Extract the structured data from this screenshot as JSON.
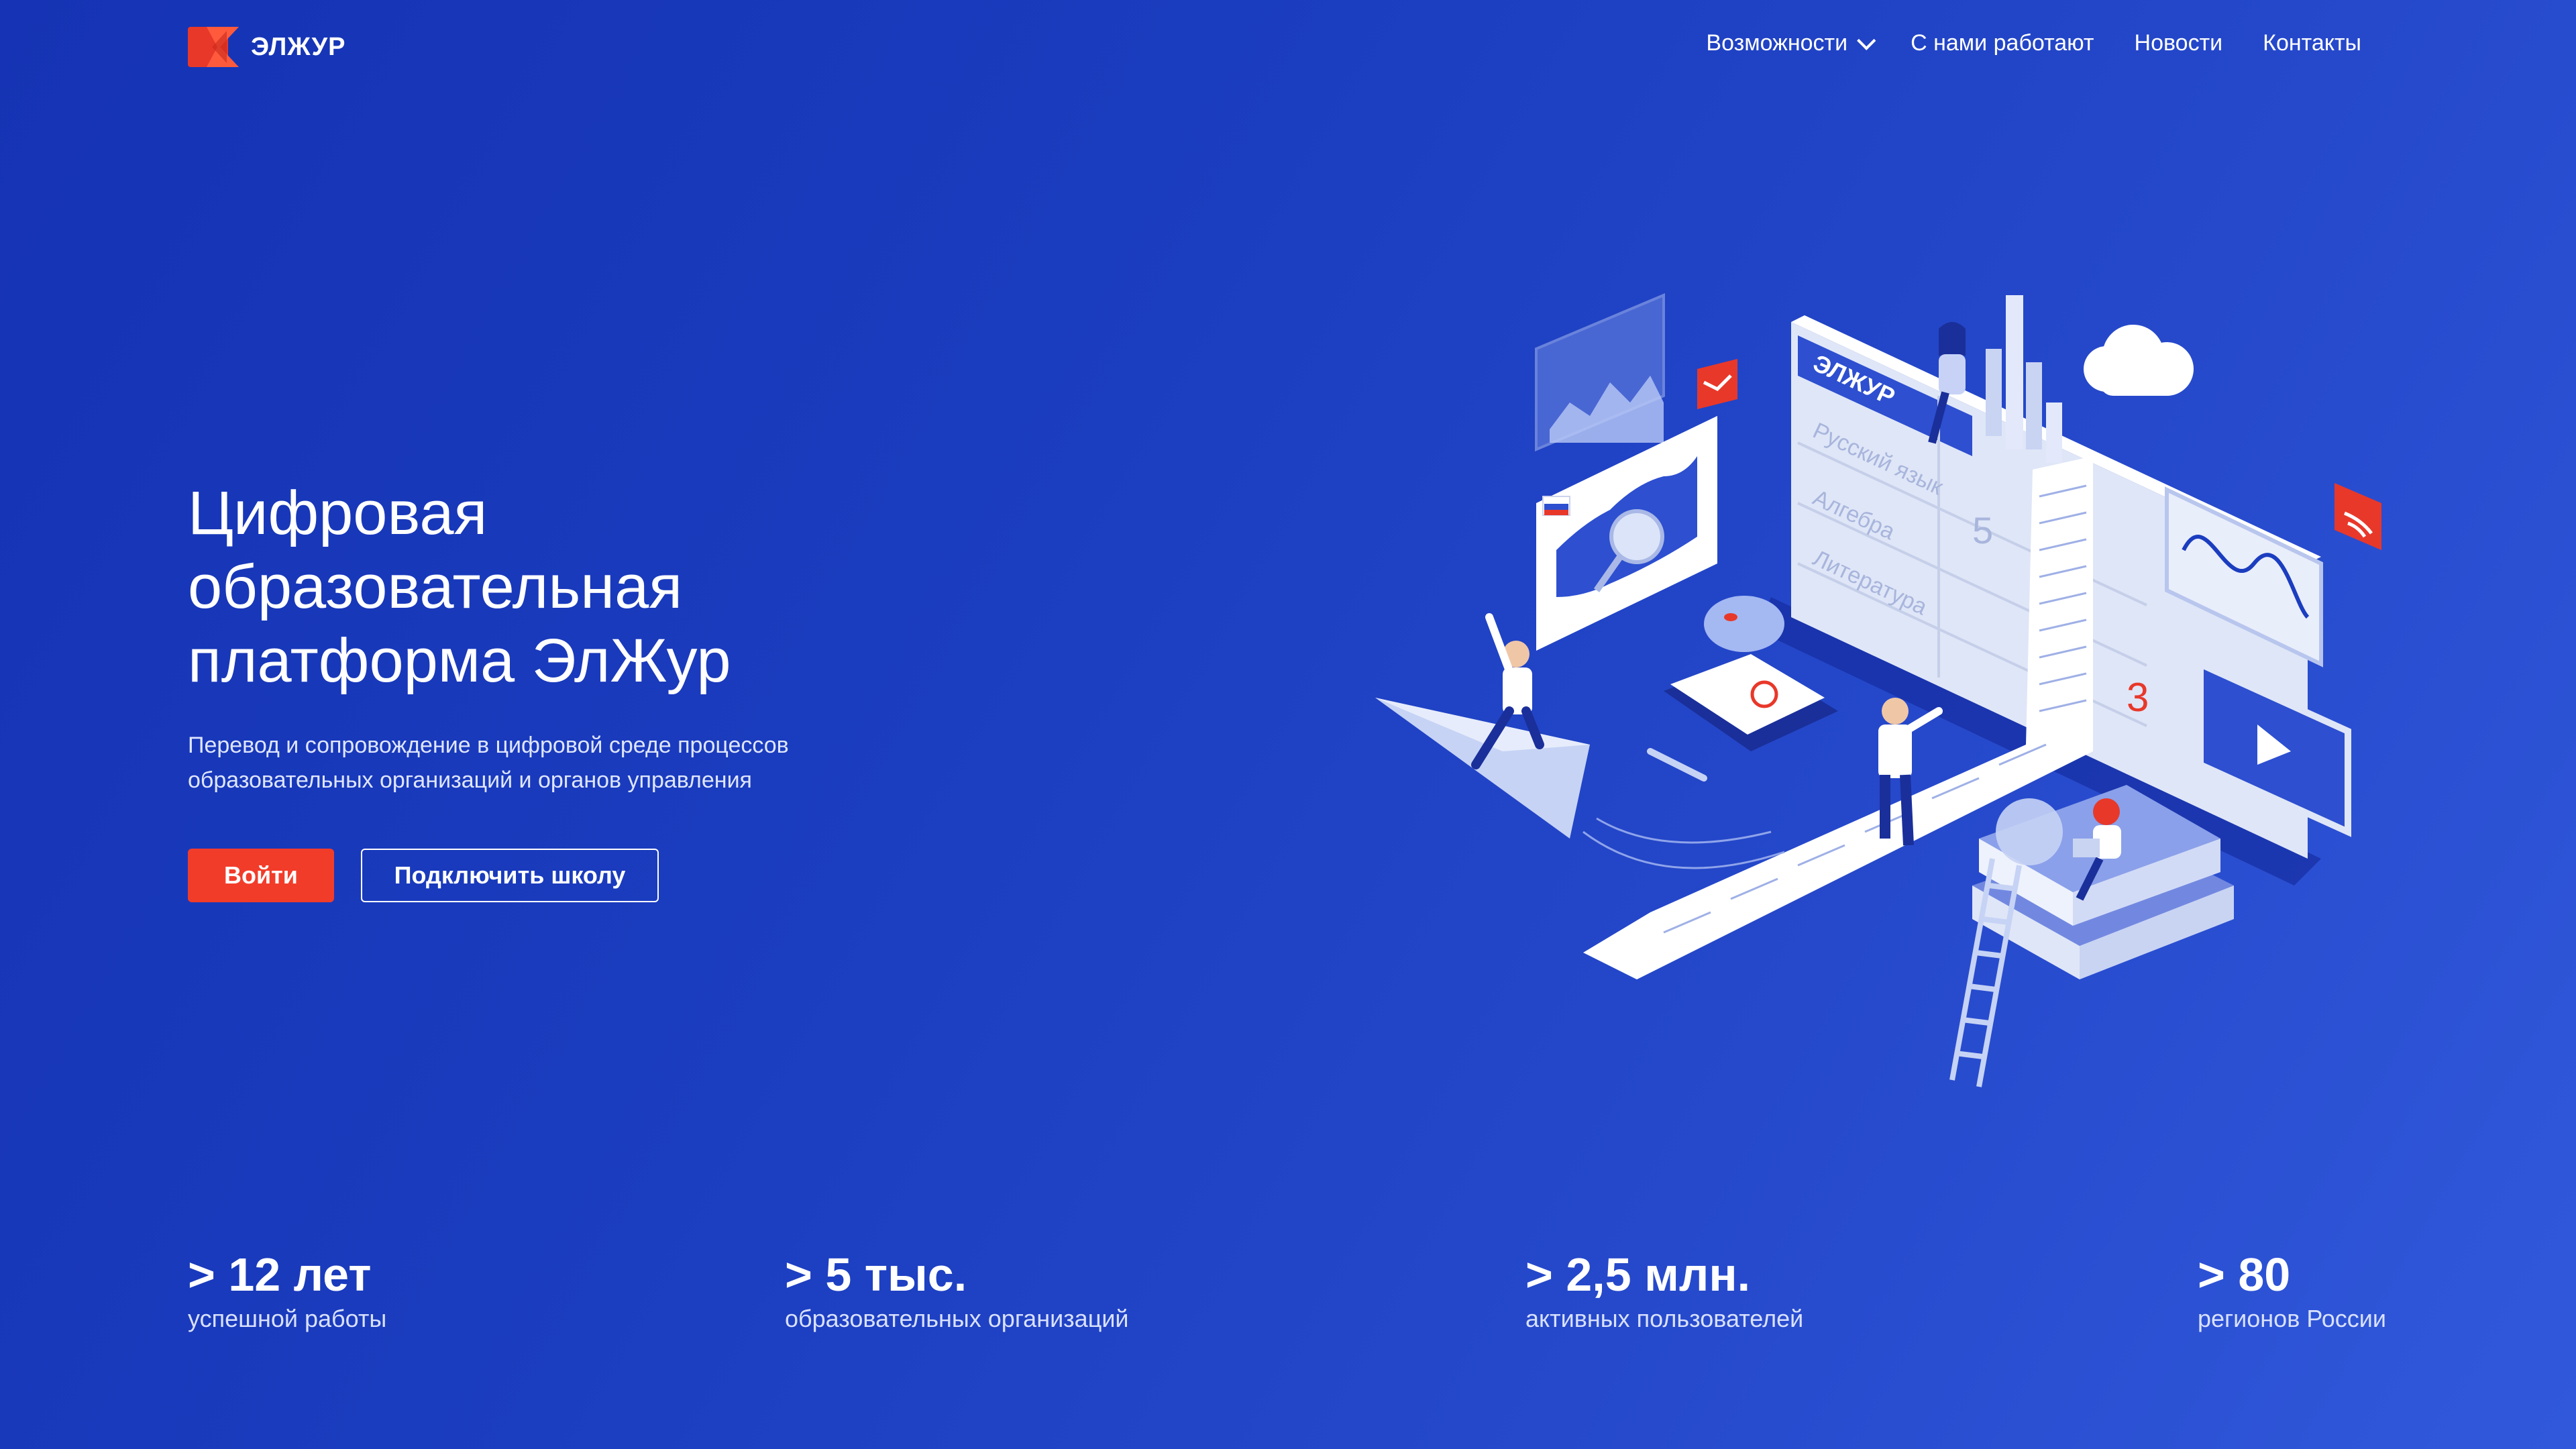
{
  "header": {
    "logo_text": "ЭЛЖУР",
    "nav": [
      {
        "label": "Возможности",
        "has_dropdown": true
      },
      {
        "label": "С нами работают"
      },
      {
        "label": "Новости"
      },
      {
        "label": "Контакты"
      }
    ]
  },
  "hero": {
    "title_line1": "Цифровая",
    "title_line2": "образовательная",
    "title_line3": "платформа ЭлЖур",
    "subtitle_line1": "Перевод и сопровождение в цифровой среде процессов",
    "subtitle_line2": "образовательных организаций и органов управления",
    "login_label": "Войти",
    "connect_label": "Подключить школу"
  },
  "illustration": {
    "board_title": "ЭЛЖУР",
    "subjects": [
      "Русский язык",
      "Алгебра",
      "Литература"
    ],
    "grades": [
      "5",
      "3"
    ]
  },
  "stats": [
    {
      "value": "> 12 лет",
      "label": "успешной работы"
    },
    {
      "value": "> 5 тыс.",
      "label": "образовательных организаций"
    },
    {
      "value": "> 2,5 млн.",
      "label": "активных пользователей"
    },
    {
      "value": "> 80",
      "label": "регионов России"
    }
  ],
  "colors": {
    "background": "#1b3dbf",
    "accent": "#f23c2a"
  }
}
